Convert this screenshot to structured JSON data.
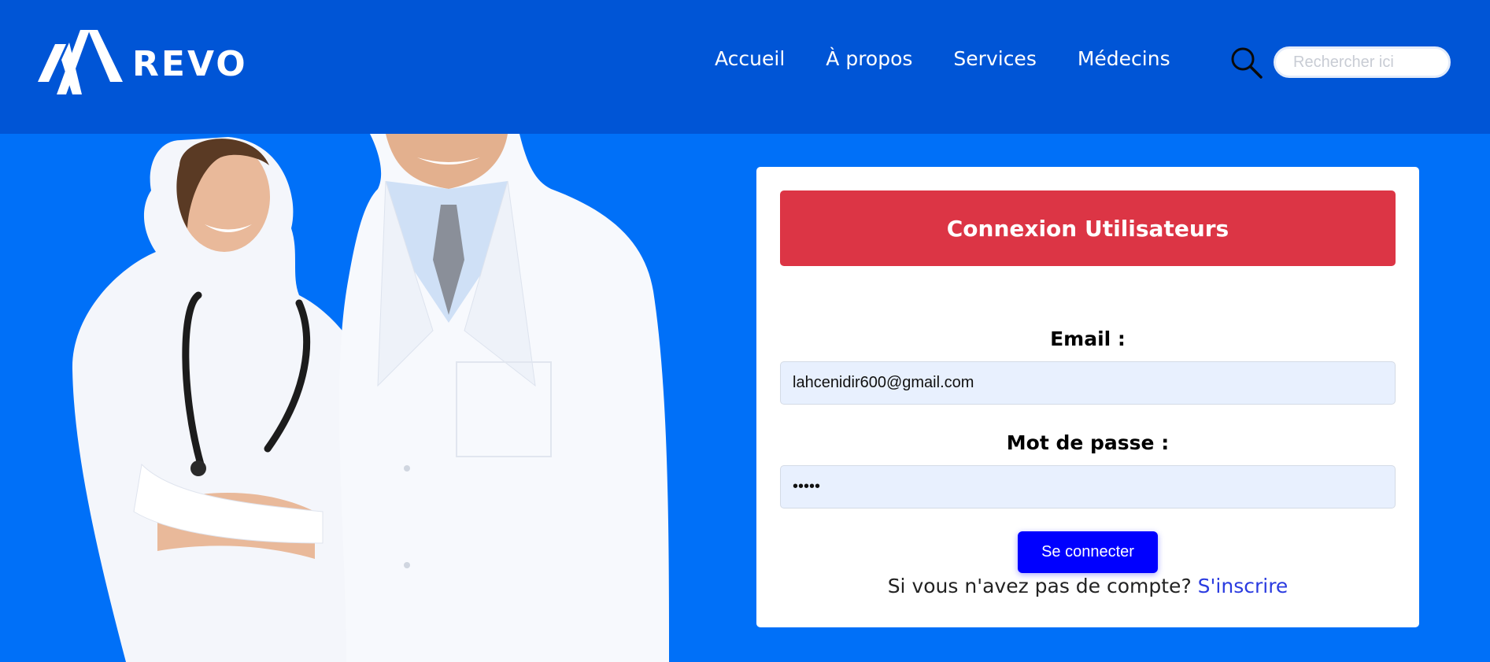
{
  "brand": {
    "name": "REVO"
  },
  "nav": {
    "items": [
      {
        "label": "Accueil"
      },
      {
        "label": "À propos"
      },
      {
        "label": "Services"
      },
      {
        "label": "Médecins"
      }
    ]
  },
  "search": {
    "placeholder": "Rechercher ici",
    "icon": "search-icon"
  },
  "login": {
    "title": "Connexion Utilisateurs",
    "email_label": "Email :",
    "email_value": "lahcenidir600@gmail.com",
    "password_label": "Mot de passe :",
    "password_value": "•••••",
    "submit_label": "Se connecter",
    "signup_prompt": "Si vous n'avez pas de compte?",
    "signup_link": "S'inscrire"
  },
  "colors": {
    "header_bg": "#0055d6",
    "page_bg": "#0070f8",
    "card_header": "#dc3545",
    "button": "#0000ff",
    "link": "#2a3be0",
    "input_bg": "#e8f0fe"
  }
}
